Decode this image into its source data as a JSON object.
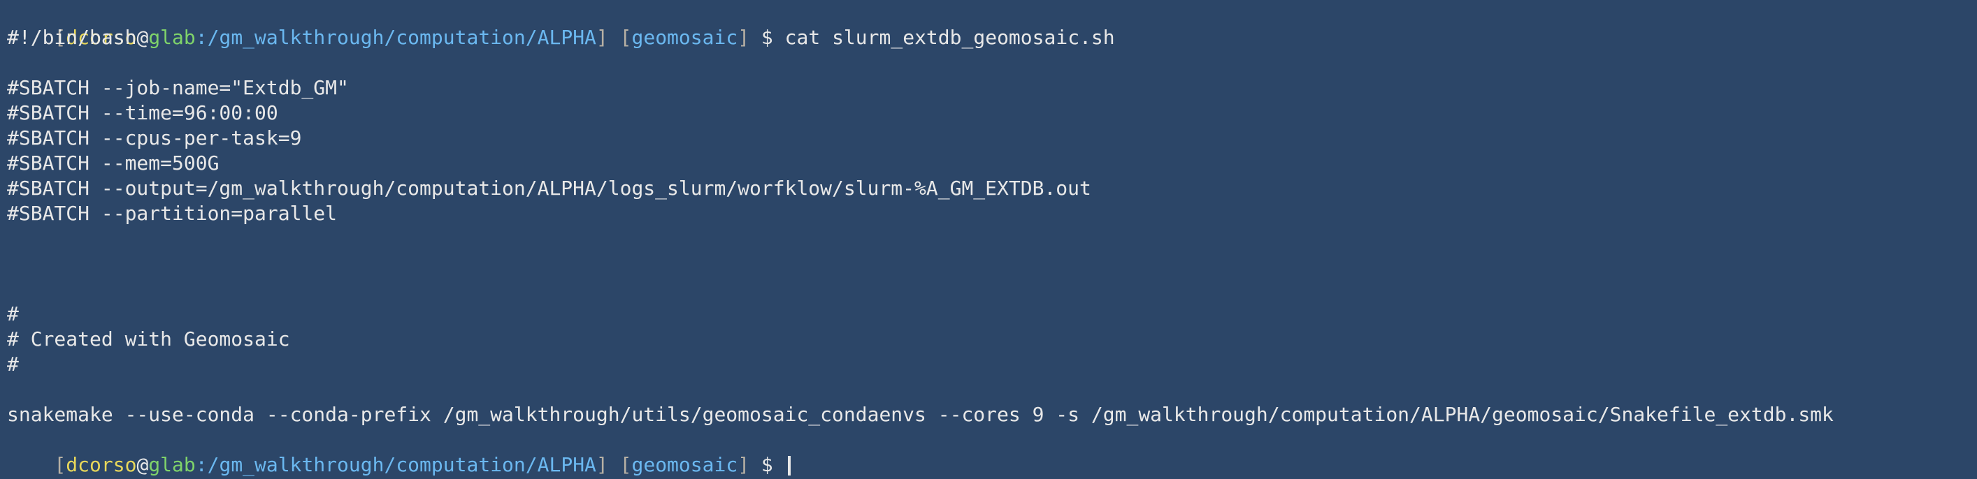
{
  "prompt": {
    "open_bracket": "[",
    "user": "dcorso",
    "at": "@",
    "host": "glab",
    "colon": ":",
    "path": "/gm_walkthrough/computation/ALPHA",
    "close_bracket": "]",
    "env_open": " [",
    "env": "geomosaic",
    "env_close": "]",
    "dollar": " $ "
  },
  "command": "cat slurm_extdb_geomosaic.sh",
  "script_lines": {
    "shebang": "#!/bin/bash",
    "job_name": "#SBATCH --job-name=\"Extdb_GM\"",
    "time": "#SBATCH --time=96:00:00",
    "cpus": "#SBATCH --cpus-per-task=9",
    "mem": "#SBATCH --mem=500G",
    "output": "#SBATCH --output=/gm_walkthrough/computation/ALPHA/logs_slurm/worfklow/slurm-%A_GM_EXTDB.out",
    "partition": "#SBATCH --partition=parallel",
    "comment_hash_1": "#",
    "comment_created": "# Created with Geomosaic",
    "comment_hash_2": "#",
    "snakemake": "snakemake --use-conda --conda-prefix /gm_walkthrough/utils/geomosaic_condaenvs --cores 9 -s /gm_walkthrough/computation/ALPHA/geomosaic/Snakefile_extdb.smk"
  },
  "colors": {
    "background": "#2c4668",
    "user": "#e8d75a",
    "host": "#7fd36a",
    "path": "#6bb8f0",
    "text": "#e8e8e8"
  }
}
